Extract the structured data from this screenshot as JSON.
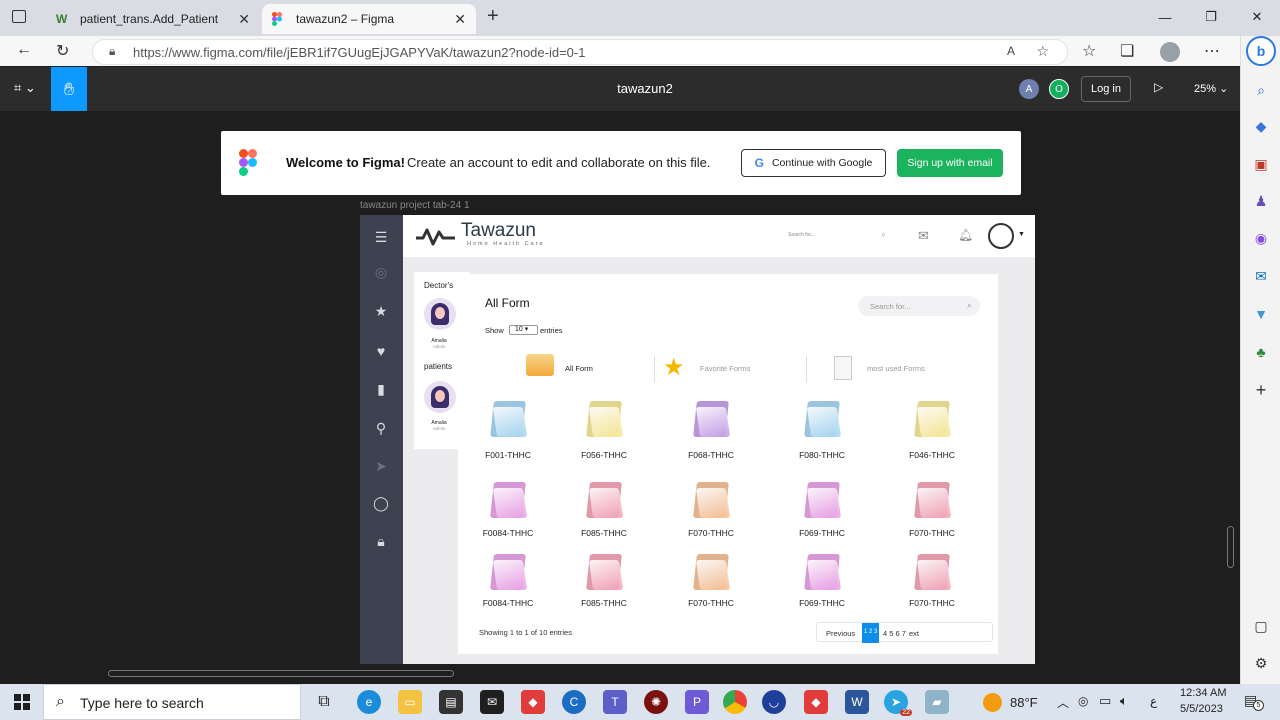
{
  "browser": {
    "tabs": [
      {
        "title": "patient_trans.Add_Patient",
        "active": false
      },
      {
        "title": "tawazun2 – Figma",
        "active": true
      }
    ],
    "new_tab": "+",
    "url_host": "https://www.figma.com",
    "url_path": "/file/jEBR1if7GUugEjJGAPYVaK/tawazun2?node-id=0-1"
  },
  "figma": {
    "file_title": "tawazun2",
    "avatars": [
      "A",
      "O"
    ],
    "login_label": "Log in",
    "zoom": "25%",
    "welcome_title": "Welcome to Figma!",
    "welcome_text": "Create an account to edit and collaborate on this file.",
    "google_label": "Continue with Google",
    "signup_label": "Sign up with email",
    "frame_label": "tawazun project tab-24 1"
  },
  "app": {
    "brand": "Tawazun",
    "tagline": "Home Health Care",
    "header_search": "Search for...",
    "doctors_label": "Dector's",
    "patients_label": "patients",
    "person_name": "Amalia",
    "person_role": "Admin",
    "panel_title": "All Form",
    "show_label": "Show",
    "show_value": "10",
    "entries_label": "entries",
    "search_placeholder": "Search for...",
    "categories": [
      {
        "label": "All Form"
      },
      {
        "label": "Favorite Forms"
      },
      {
        "label": "most used Forms"
      }
    ],
    "folders": [
      {
        "label": "F001-THHC",
        "color": "#a9d6f2"
      },
      {
        "label": "F056-THHC",
        "color": "#f6e79a"
      },
      {
        "label": "F068-THHC",
        "color": "#c8a3e8"
      },
      {
        "label": "F080-THHC",
        "color": "#a9d6f2"
      },
      {
        "label": "F046-THHC",
        "color": "#f6e79a"
      },
      {
        "label": "F0084-THHC",
        "color": "#e9a5e6"
      },
      {
        "label": "F085-THHC",
        "color": "#f2a6b8"
      },
      {
        "label": "F070-THHC",
        "color": "#f5c29a"
      },
      {
        "label": "F069-THHC",
        "color": "#e9a5e6"
      },
      {
        "label": "F070-THHC",
        "color": "#f2a6b8"
      },
      {
        "label": "F0084-THHC",
        "color": "#e9a5e6"
      },
      {
        "label": "F085-THHC",
        "color": "#f2a6b8"
      },
      {
        "label": "F070-THHC",
        "color": "#f5c29a"
      },
      {
        "label": "F069-THHC",
        "color": "#e9a5e6"
      },
      {
        "label": "F070-THHC",
        "color": "#f2a6b8"
      }
    ],
    "showing_text": "Showing 1 to 1 of 10 entries",
    "pagination": {
      "previous": "Previous",
      "pages_active": "1 2 3",
      "pages_rest": "4 5 6 7",
      "next": "ext"
    }
  },
  "taskbar": {
    "search_placeholder": "Type here to search",
    "weather": "88°F",
    "time": "12:34 AM",
    "date": "5/5/2023",
    "lang": "ع",
    "badge_telegram": "22",
    "notif_count": "5"
  },
  "colors": {
    "figma_blue": "#0d99ff",
    "signup_green": "#1bb35d",
    "sidebar_dark": "#3d4150",
    "page_active": "#0c8ee9"
  }
}
